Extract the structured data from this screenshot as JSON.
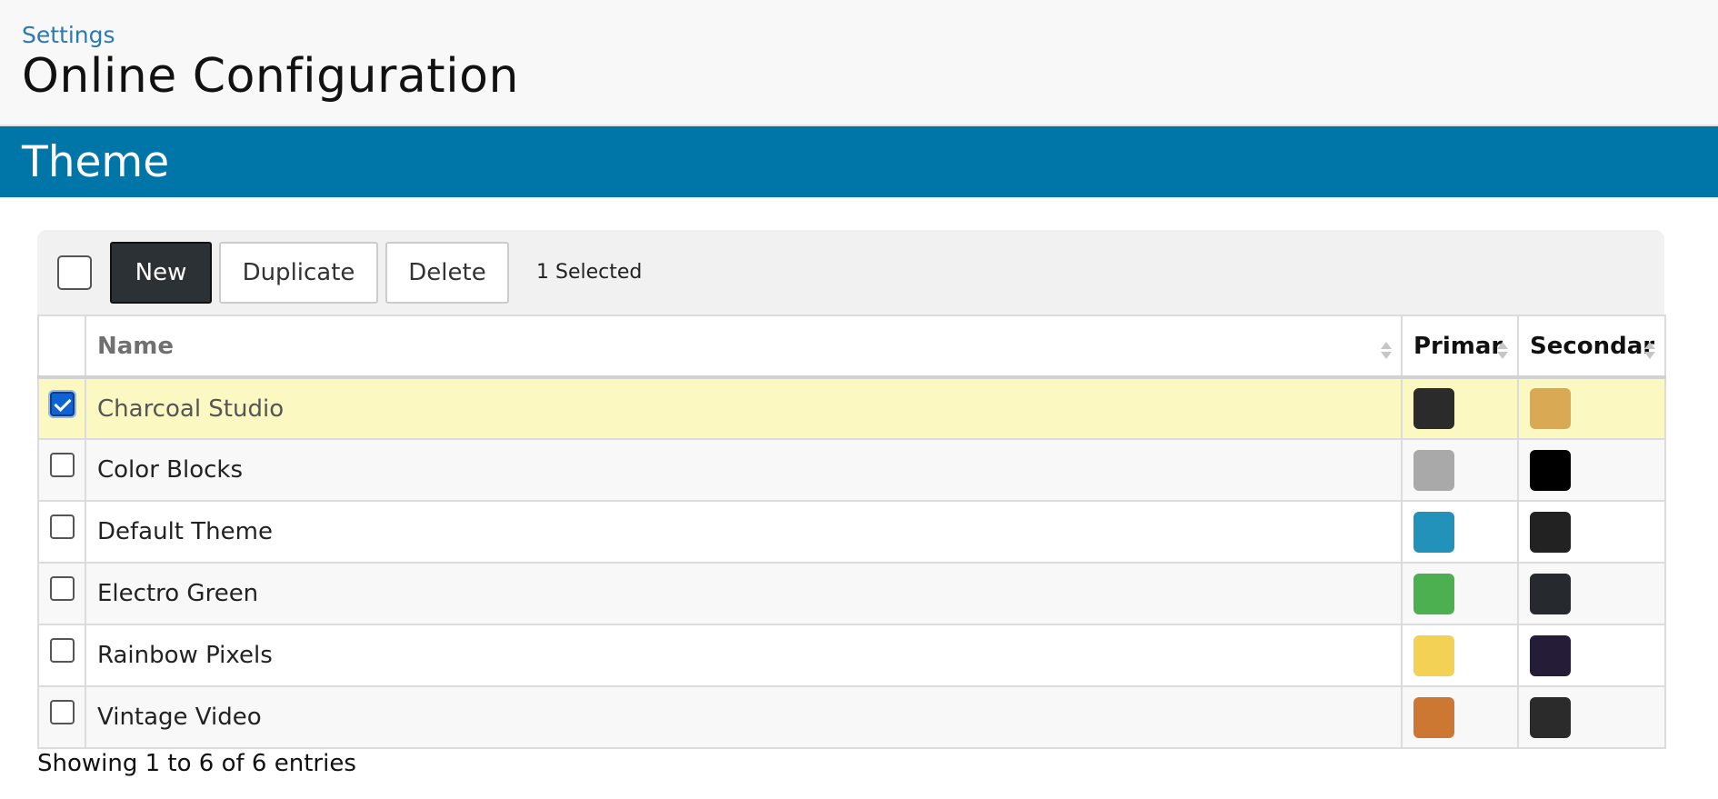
{
  "header": {
    "breadcrumb": "Settings",
    "title": "Online Configuration"
  },
  "section": {
    "title": "Theme"
  },
  "toolbar": {
    "new_label": "New",
    "duplicate_label": "Duplicate",
    "delete_label": "Delete",
    "selected_text": "1 Selected",
    "select_all_checked": false
  },
  "table": {
    "columns": {
      "name": "Name",
      "primary": "Primar",
      "secondary": "Secondar"
    },
    "rows": [
      {
        "name": "Charcoal Studio",
        "checked": true,
        "primary": "#2b2b2b",
        "secondary": "#d9a954"
      },
      {
        "name": "Color Blocks",
        "checked": false,
        "primary": "#a9a9a9",
        "secondary": "#000000"
      },
      {
        "name": "Default Theme",
        "checked": false,
        "primary": "#2292bb",
        "secondary": "#222222"
      },
      {
        "name": "Electro Green",
        "checked": false,
        "primary": "#4caf50",
        "secondary": "#262a2e"
      },
      {
        "name": "Rainbow Pixels",
        "checked": false,
        "primary": "#f3d154",
        "secondary": "#251d38"
      },
      {
        "name": "Vintage Video",
        "checked": false,
        "primary": "#cc7832",
        "secondary": "#2b2b2b"
      }
    ]
  },
  "footer": {
    "info": "Showing 1 to 6 of 6 entries"
  }
}
